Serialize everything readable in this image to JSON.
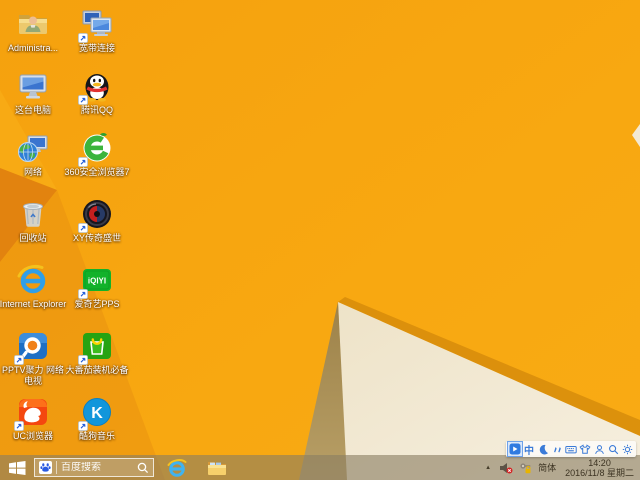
{
  "colors": {
    "wallpaper_orange": "#f7a60f",
    "wallpaper_dark_orange": "#e2830f",
    "wallpaper_cream": "#f2e8d1",
    "wallpaper_khaki": "#ac9058",
    "taskbar_tint": "#b59047",
    "ime_blue": "#3b7bd8"
  },
  "desktop": {
    "icons": [
      {
        "name": "administrator-folder",
        "label": "Administra...",
        "shortcut": false
      },
      {
        "name": "broadband-connection",
        "label": "宽带连接",
        "shortcut": true
      },
      {
        "name": "this-pc",
        "label": "这台电脑",
        "shortcut": false
      },
      {
        "name": "tencent-qq",
        "label": "腾讯QQ",
        "shortcut": true
      },
      {
        "name": "network",
        "label": "网络",
        "shortcut": false
      },
      {
        "name": "360-browser",
        "label": "360安全浏览器7",
        "shortcut": true
      },
      {
        "name": "recycle-bin",
        "label": "回收站",
        "shortcut": false
      },
      {
        "name": "xy-game",
        "label": "XY传奇盛世",
        "shortcut": true
      },
      {
        "name": "internet-explorer",
        "label": "Internet Explorer",
        "shortcut": false
      },
      {
        "name": "iqiyi-pps",
        "label": "爱奇艺PPS",
        "shortcut": true
      },
      {
        "name": "pptv",
        "label": "PPTV聚力 网络电视",
        "shortcut": true
      },
      {
        "name": "big-tomato",
        "label": "大番茄装机必备",
        "shortcut": true
      },
      {
        "name": "uc-browser",
        "label": "UC浏览器",
        "shortcut": true
      },
      {
        "name": "kugou-music",
        "label": "酷狗音乐",
        "shortcut": true
      }
    ]
  },
  "taskbar": {
    "search": {
      "placeholder": "百度搜索"
    },
    "tray": {
      "language_label": "简体",
      "time": "14:20",
      "date": "2016/11/8 星期二"
    }
  },
  "ime_bar": {
    "icons": [
      {
        "name": "baidu-ime-logo",
        "active": true,
        "glyph": ""
      },
      {
        "name": "chinese-mode",
        "active": false,
        "glyph": "中"
      },
      {
        "name": "fullwidth-toggle-moon",
        "active": false,
        "glyph": ""
      },
      {
        "name": "chinese-punctuation",
        "active": false,
        "glyph": ""
      },
      {
        "name": "soft-keyboard",
        "active": false,
        "glyph": ""
      },
      {
        "name": "ime-skin",
        "active": false,
        "glyph": ""
      },
      {
        "name": "ime-account",
        "active": false,
        "glyph": ""
      },
      {
        "name": "ime-search",
        "active": false,
        "glyph": ""
      },
      {
        "name": "ime-settings",
        "active": false,
        "glyph": ""
      }
    ]
  }
}
